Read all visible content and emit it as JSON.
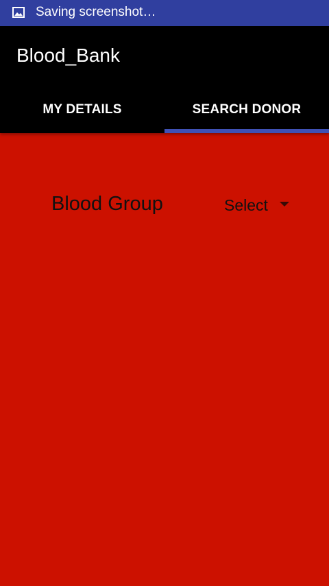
{
  "status_bar": {
    "notification_icon": "image-icon",
    "text": "Saving screenshot…",
    "background": "#303f9f"
  },
  "app_bar": {
    "title": "Blood_Bank",
    "background": "#000000"
  },
  "tabs": [
    {
      "label": "MY DETAILS",
      "selected": false
    },
    {
      "label": "SEARCH DONOR",
      "selected": true
    }
  ],
  "tab_indicator_color": "#3f51b5",
  "content": {
    "background": "#cc1100",
    "blood_group_label": "Blood Group",
    "blood_group_select": {
      "value": "Select",
      "icon": "dropdown-arrow-icon"
    }
  }
}
